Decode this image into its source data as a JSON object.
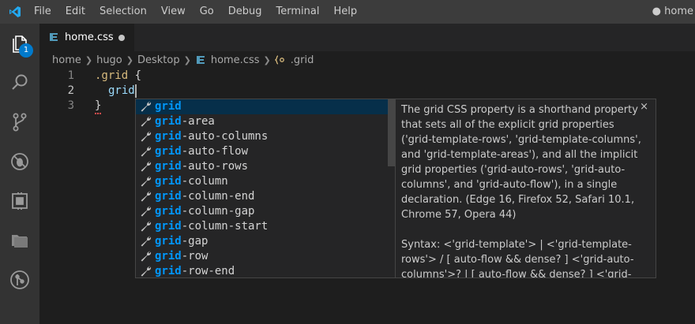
{
  "menu": {
    "items": [
      "File",
      "Edit",
      "Selection",
      "View",
      "Go",
      "Debug",
      "Terminal",
      "Help"
    ]
  },
  "window": {
    "title": "● home"
  },
  "activity": {
    "explorer_badge": "1"
  },
  "tab": {
    "label": "home.css"
  },
  "breadcrumb": {
    "parts": [
      "home",
      "hugo",
      "Desktop",
      "home.css",
      ".grid"
    ]
  },
  "editor": {
    "lines": [
      {
        "num": "1",
        "selector": ".grid",
        "brace": " {"
      },
      {
        "num": "2",
        "text": "grid"
      },
      {
        "num": "3",
        "brace": "}"
      }
    ]
  },
  "suggest": {
    "match": "grid",
    "items": [
      {
        "match": "grid",
        "rest": ""
      },
      {
        "match": "grid",
        "rest": "-area"
      },
      {
        "match": "grid",
        "rest": "-auto-columns"
      },
      {
        "match": "grid",
        "rest": "-auto-flow"
      },
      {
        "match": "grid",
        "rest": "-auto-rows"
      },
      {
        "match": "grid",
        "rest": "-column"
      },
      {
        "match": "grid",
        "rest": "-column-end"
      },
      {
        "match": "grid",
        "rest": "-column-gap"
      },
      {
        "match": "grid",
        "rest": "-column-start"
      },
      {
        "match": "grid",
        "rest": "-gap"
      },
      {
        "match": "grid",
        "rest": "-row"
      },
      {
        "match": "grid",
        "rest": "-row-end"
      }
    ]
  },
  "details": {
    "description": "The grid CSS property is a shorthand property that sets all of the explicit grid properties ('grid-template-rows', 'grid-template-columns', and 'grid-template-areas'), and all the implicit grid properties ('grid-auto-rows', 'grid-auto-columns', and 'grid-auto-flow'), in a single declaration. (Edge 16, Firefox 52, Safari 10.1, Chrome 57, Opera 44)",
    "syntax": "Syntax: <'grid-template'> | <'grid-template-rows'> / [ auto-flow && dense? ] <'grid-auto-columns'>? | [ auto-flow && dense? ] <'grid-auto-rows'>? / <'grid-template-columns'>",
    "close": "×"
  },
  "colors": {
    "accent": "#007acc",
    "match_highlight": "#0097fb",
    "selected_row": "#062f4a",
    "css_icon": "#519aba"
  }
}
